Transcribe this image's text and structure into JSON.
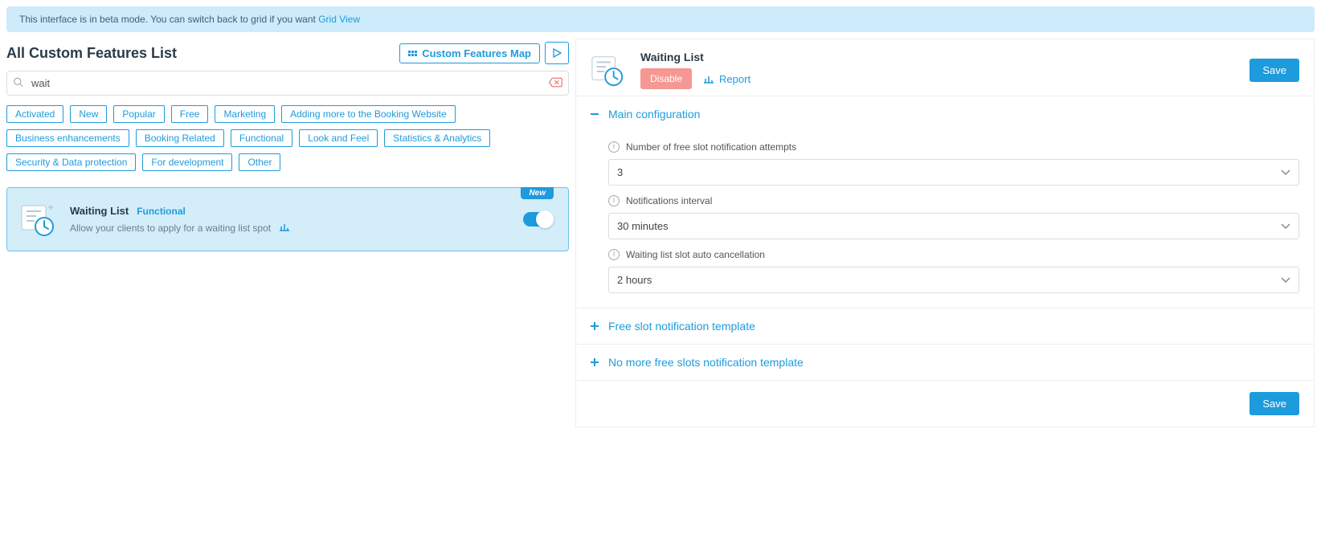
{
  "banner": {
    "text": "This interface is in beta mode. You can switch back to grid if you want ",
    "link": "Grid View"
  },
  "header": {
    "title": "All Custom Features List",
    "map_link": "Custom Features Map"
  },
  "search": {
    "value": "wait"
  },
  "filters": [
    "Activated",
    "New",
    "Popular",
    "Free",
    "Marketing",
    "Adding more to the Booking Website",
    "Business enhancements",
    "Booking Related",
    "Functional",
    "Look and Feel",
    "Statistics & Analytics",
    "Security & Data protection",
    "For development",
    "Other"
  ],
  "feature": {
    "title": "Waiting List",
    "badge": "New",
    "category": "Functional",
    "description": "Allow your clients to apply for a waiting list spot"
  },
  "detail": {
    "title": "Waiting List",
    "disable": "Disable",
    "report": "Report",
    "save": "Save"
  },
  "sections": {
    "main": {
      "title": "Main configuration",
      "fields": {
        "attempts_label": "Number of free slot notification attempts",
        "attempts_value": "3",
        "interval_label": "Notifications interval",
        "interval_value": "30 minutes",
        "cancel_label": "Waiting list slot auto cancellation",
        "cancel_value": "2 hours"
      }
    },
    "template1": "Free slot notification template",
    "template2": "No more free slots notification template"
  }
}
